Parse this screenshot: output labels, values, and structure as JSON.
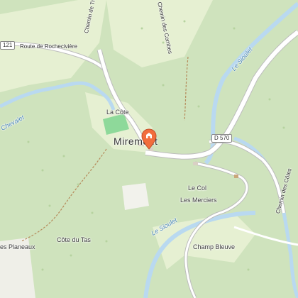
{
  "map": {
    "labels": {
      "la_cote": "La Côte",
      "miremont": "Miremont",
      "le_col": "Le Col",
      "les_merciers": "Les Merciers",
      "cote_du_tas": "Côte du Tas",
      "champ_bleuve": "Champ Bleuve",
      "les_planeaux": "es Planeaux",
      "route_rochecivierre": "Route de Rochecivière",
      "chemin_travers": "Chemin de Travers",
      "chemin_combes": "Chemin des Combes",
      "chemin_cotes": "Chemin des Côtes",
      "river_sioulet_1": "Le Sioulet",
      "river_sioulet_2": "Le Sioulet",
      "river_chevalet": "Chevalet"
    },
    "shields": {
      "d121": "121",
      "d570": "D 570"
    },
    "colors": {
      "forest": "#cfe3bd",
      "meadow": "#e6f0d2",
      "water": "#b9d9f0",
      "road": "#ffffff",
      "pin": "#f26d3d"
    },
    "marker_icon": "location-pin-icon"
  }
}
